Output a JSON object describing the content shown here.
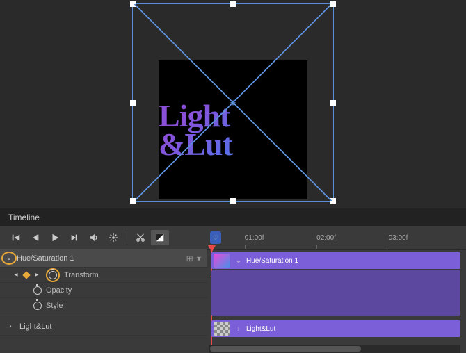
{
  "canvas": {
    "logo_text": "Light &Lut"
  },
  "timeline": {
    "panel_title": "Timeline",
    "ruler": [
      "01:00f",
      "02:00f",
      "03:00f"
    ],
    "marker_icon": "♡",
    "layers": [
      {
        "name": "Hue/Saturation 1",
        "expanded": true,
        "selected": true,
        "options_icon": "⊞ ▾",
        "clip_label": "Hue/Saturation 1",
        "sublayers": [
          {
            "name": "Transform",
            "has_keyframes": true,
            "highlighted_stopwatch": true
          },
          {
            "name": "Opacity"
          },
          {
            "name": "Style"
          }
        ]
      },
      {
        "name": "Light&Lut",
        "expanded": false,
        "clip_label": "Light&Lut"
      }
    ]
  }
}
